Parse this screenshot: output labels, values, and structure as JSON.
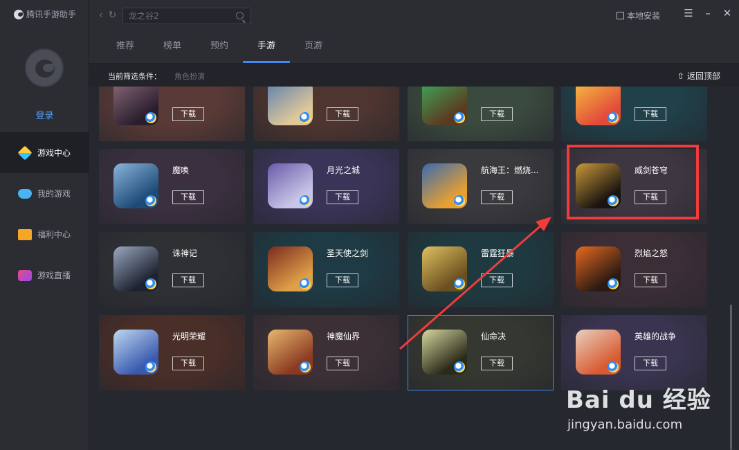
{
  "app": {
    "name": "腾讯手游助手"
  },
  "sidebar": {
    "login_label": "登录",
    "items": [
      {
        "label": "游戏中心",
        "icon": "game-center-icon",
        "active": true
      },
      {
        "label": "我的游戏",
        "icon": "gamepad-icon",
        "active": false
      },
      {
        "label": "福利中心",
        "icon": "gift-icon",
        "active": false
      },
      {
        "label": "游戏直播",
        "icon": "live-icon",
        "active": false
      }
    ]
  },
  "toolbar": {
    "search_placeholder": "龙之谷2",
    "local_install_label": "本地安装"
  },
  "tabs": [
    {
      "label": "推荐",
      "active": false
    },
    {
      "label": "榜单",
      "active": false
    },
    {
      "label": "预约",
      "active": false
    },
    {
      "label": "手游",
      "active": true
    },
    {
      "label": "页游",
      "active": false
    }
  ],
  "filter": {
    "label": "当前筛选条件：",
    "value": "角色扮演",
    "back_top_label": "返回顶部"
  },
  "download_label": "下载",
  "games": [
    {
      "name": "",
      "bg": "#5a3a36",
      "icon_colors": [
        "#2a1e2e",
        "#8a6a7a"
      ],
      "row": 0,
      "col": 0
    },
    {
      "name": "",
      "bg": "#4e3530",
      "icon_colors": [
        "#e0c89a",
        "#5a7fb0"
      ],
      "row": 0,
      "col": 1
    },
    {
      "name": "",
      "bg": "#3a4a3e",
      "icon_colors": [
        "#5a3a20",
        "#3fa85a"
      ],
      "row": 0,
      "col": 2
    },
    {
      "name": "",
      "bg": "#20404a",
      "icon_colors": [
        "#e24a3a",
        "#f5c040"
      ],
      "row": 0,
      "col": 3
    },
    {
      "name": "魔唤",
      "bg": "#3b3040",
      "icon_colors": [
        "#1e4a78",
        "#8ab4d8"
      ],
      "row": 1,
      "col": 0
    },
    {
      "name": "月光之城",
      "bg": "#3a3458",
      "icon_colors": [
        "#c8c6e8",
        "#6a5aa8"
      ],
      "row": 1,
      "col": 1
    },
    {
      "name": "航海王：燃烧...",
      "bg": "#3a3a3e",
      "icon_colors": [
        "#e8a030",
        "#3a6ab0"
      ],
      "row": 1,
      "col": 2
    },
    {
      "name": "威剑苍穹",
      "bg": "#3e3640",
      "icon_colors": [
        "#1a1410",
        "#c89a3a"
      ],
      "row": 1,
      "col": 3
    },
    {
      "name": "诛神记",
      "bg": "#2e3034",
      "icon_colors": [
        "#1e2230",
        "#9aa8c0"
      ],
      "row": 2,
      "col": 0
    },
    {
      "name": "圣天使之剑",
      "bg": "#1e3a44",
      "icon_colors": [
        "#e0a048",
        "#7a2a20"
      ],
      "row": 2,
      "col": 1
    },
    {
      "name": "雷霆狂暴",
      "bg": "#1e3a40",
      "icon_colors": [
        "#6a5020",
        "#e0c060"
      ],
      "row": 2,
      "col": 2
    },
    {
      "name": "烈焰之怒",
      "bg": "#3c2e36",
      "icon_colors": [
        "#2a1a12",
        "#e86a20"
      ],
      "row": 2,
      "col": 3
    },
    {
      "name": "光明荣耀",
      "bg": "#4a2e28",
      "icon_colors": [
        "#3a5ab0",
        "#c0d8f0"
      ],
      "row": 3,
      "col": 0
    },
    {
      "name": "神魔仙界",
      "bg": "#3c3036",
      "icon_colors": [
        "#8a3a20",
        "#e8b870"
      ],
      "row": 3,
      "col": 1
    },
    {
      "name": "仙命决",
      "bg": "#343830",
      "icon_colors": [
        "#2a2a1a",
        "#d8d8a0"
      ],
      "row": 3,
      "col": 2,
      "selected": true
    },
    {
      "name": "英雄的战争",
      "bg": "#3a3450",
      "icon_colors": [
        "#d85a30",
        "#e8d0c0"
      ],
      "row": 3,
      "col": 3
    }
  ],
  "watermark": {
    "logo": "Bai du 经验",
    "url": "jingyan.baidu.com"
  }
}
